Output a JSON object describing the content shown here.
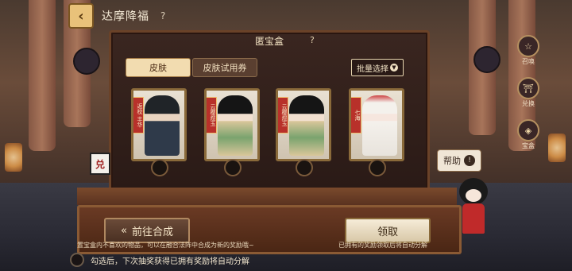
{
  "header": {
    "back_icon": "chevron-left-icon",
    "title": "达摩降福",
    "help": "?"
  },
  "panel": {
    "title": "匿宝盒",
    "help": "?",
    "tabs": [
      {
        "label": "皮肤",
        "active": true
      },
      {
        "label": "皮肤试用券",
        "active": false
      }
    ],
    "batch_select": "批量选择"
  },
  "cards": [
    {
      "name_lines": "返校 丰华",
      "style": "hair-dark"
    },
    {
      "name_lines": "云樱煜玉",
      "style": "hair-black"
    },
    {
      "name_lines": "云樱煜玉",
      "style": "hair-black"
    },
    {
      "name_lines": "七海",
      "style": "hair-white"
    }
  ],
  "side_menu": [
    {
      "label": "召唤",
      "icon": "summon-icon"
    },
    {
      "label": "兑换",
      "icon": "exchange-icon"
    },
    {
      "label": "宝盒",
      "icon": "box-icon"
    }
  ],
  "ticket_tag": "兑",
  "help_bubble": {
    "label": "帮助",
    "icon": "!"
  },
  "bottom": {
    "go_compose": "前往合成",
    "claim": "领取",
    "left_note": "置宝盒内不喜欢的物品，可以在融合法阵中合成为新的奖励哦~",
    "right_note": "已拥有的奖励领取后将自动分解",
    "auto_decompose": "勾选后，下次抽奖获得已拥有奖励将自动分解"
  },
  "colors": {
    "accent": "#e9c27a",
    "panel": "#2a1a16",
    "ribbon": "#b8312a"
  }
}
